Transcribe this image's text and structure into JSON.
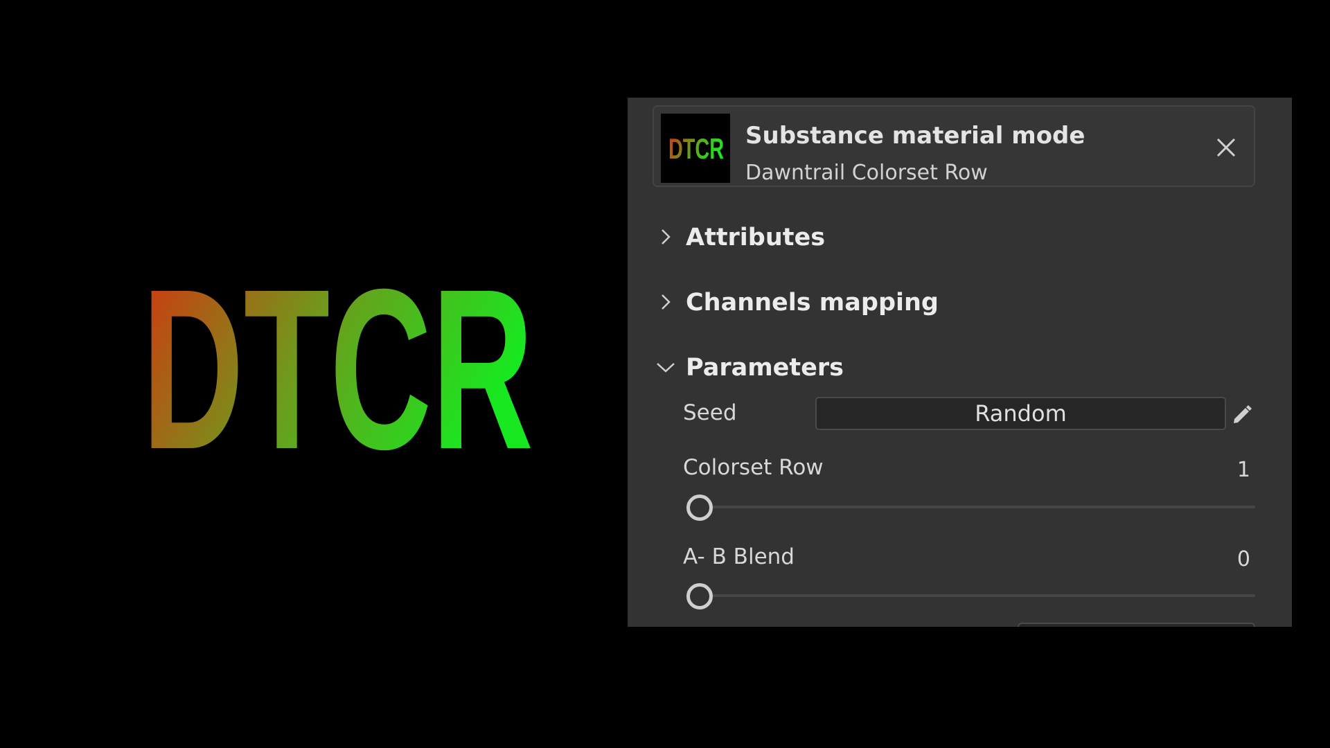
{
  "logo": {
    "text": "DTCR",
    "gradient_start": "#d83010",
    "gradient_mid": "#6f9a1c",
    "gradient_end": "#18e820"
  },
  "header": {
    "title": "Substance material mode",
    "subtitle": "Dawntrail Colorset Row",
    "thumbnail_text": "DTCR",
    "close_icon": "close-icon"
  },
  "sections": [
    {
      "label": "Attributes",
      "expanded": false,
      "icon": "chevron-right-icon"
    },
    {
      "label": "Channels mapping",
      "expanded": false,
      "icon": "chevron-right-icon"
    },
    {
      "label": "Parameters",
      "expanded": true,
      "icon": "chevron-down-icon"
    }
  ],
  "parameters": {
    "seed": {
      "label": "Seed",
      "button_label": "Random",
      "edit_icon": "pencil-icon"
    },
    "colorset_row": {
      "label": "Colorset Row",
      "value": "1",
      "slider_fraction": 0
    },
    "ab_blend": {
      "label": "A- B Blend",
      "value": "0",
      "slider_fraction": 0
    }
  },
  "colors": {
    "background": "#000000",
    "panel": "#333333",
    "text": "#e4e4e4"
  }
}
